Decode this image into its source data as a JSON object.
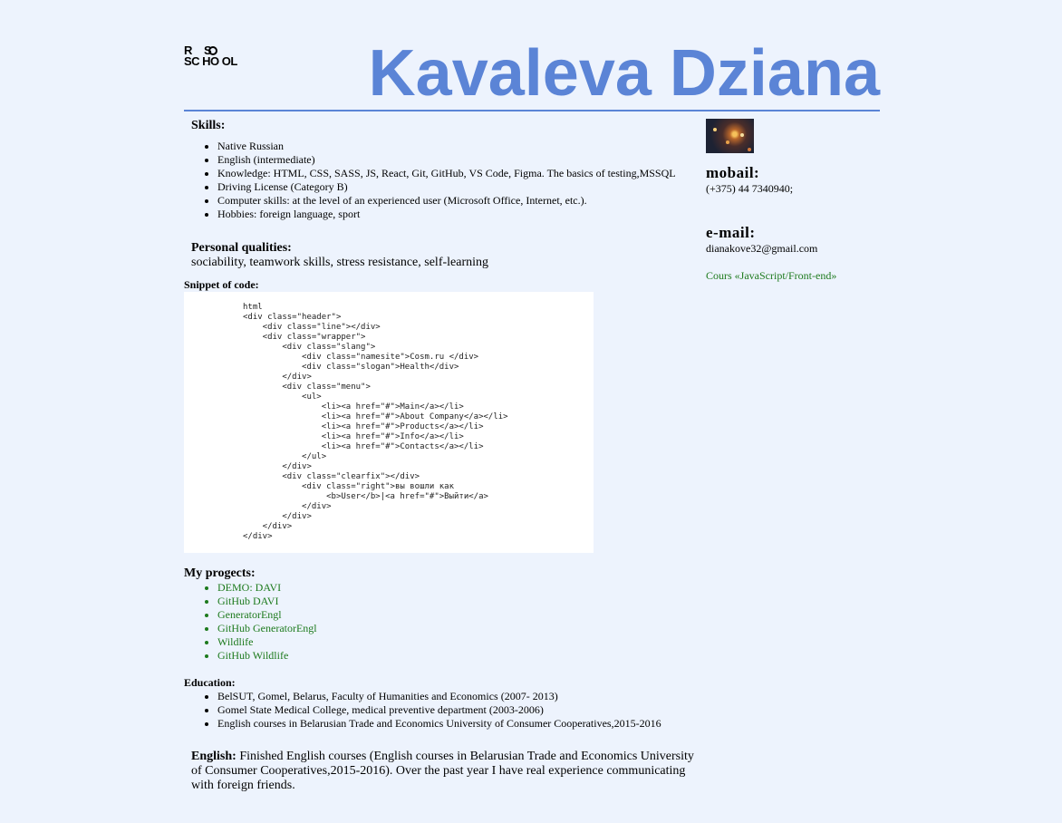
{
  "header": {
    "logo_line1": [
      "R",
      "S"
    ],
    "logo_line2": "SC HO OL",
    "name": "Kavaleva Dziana"
  },
  "skills": {
    "title": "Skills:",
    "items": [
      "Native Russian",
      "English (intermediate)",
      "Knowledge: HTML, CSS, SASS, JS, React, Git, GitHub, VS Code, Figma. The basics of testing,MSSQL",
      "Driving License (Category B)",
      "Computer skills: at the level of an experienced user (Microsoft Office, Internet, etc.).",
      "Hobbies: foreign language, sport"
    ]
  },
  "personal": {
    "title": "Personal qualities:",
    "text": "sociability, teamwork skills, stress resistance, self-learning"
  },
  "snippet": {
    "title": "Snippet of code:",
    "code": "html\n<div class=\"header\">\n    <div class=\"line\"></div>\n    <div class=\"wrapper\">\n        <div class=\"slang\">\n            <div class=\"namesite\">Cosm.ru </div>\n            <div class=\"slogan\">Health</div>\n        </div>\n        <div class=\"menu\">\n            <ul>\n                <li><a href=\"#\">Main</a></li>\n                <li><a href=\"#\">About Company</a></li>\n                <li><a href=\"#\">Products</a></li>\n                <li><a href=\"#\">Info</a></li>\n                <li><a href=\"#\">Contacts</a></li>\n            </ul>\n        </div>\n        <div class=\"clearfix\"></div>\n            <div class=\"right\">вы вошли как\n                 <b>User</b>|<a href=\"#\">Выйти</a>\n            </div>\n        </div>\n    </div>\n</div>"
  },
  "projects": {
    "title": "My progects:",
    "items": [
      "DEMO: DAVI",
      "GitHub DAVI",
      "GeneratorEngl",
      "GitHub GeneratorEngl",
      "Wildlife",
      "GitHub Wildlife"
    ]
  },
  "education": {
    "title": "Education:",
    "items": [
      "BelSUT, Gomel, Belarus, Faculty of Humanities and Economics (2007- 2013)",
      "Gomel State Medical College, medical preventive department (2003-2006)",
      "English courses in Belarusian Trade and Economics University of Consumer Cooperatives,2015-2016"
    ]
  },
  "english": {
    "label": "English:",
    "text": " Finished English courses (English courses in Belarusian Trade and Economics University of Consumer Cooperatives,2015-2016). Over the past year I have real experience communicating with foreign friends."
  },
  "contacts": {
    "mobile_title": "mobail:",
    "mobile_value": "(+375) 44 7340940;",
    "email_title": "e-mail:",
    "email_value": "dianakove32@gmail.com",
    "course_link": "Cours «JavaScript/Front-end»"
  },
  "colors": {
    "accent": "#5b84d6",
    "link": "#1d7a1d",
    "background": "#edf3fd"
  }
}
